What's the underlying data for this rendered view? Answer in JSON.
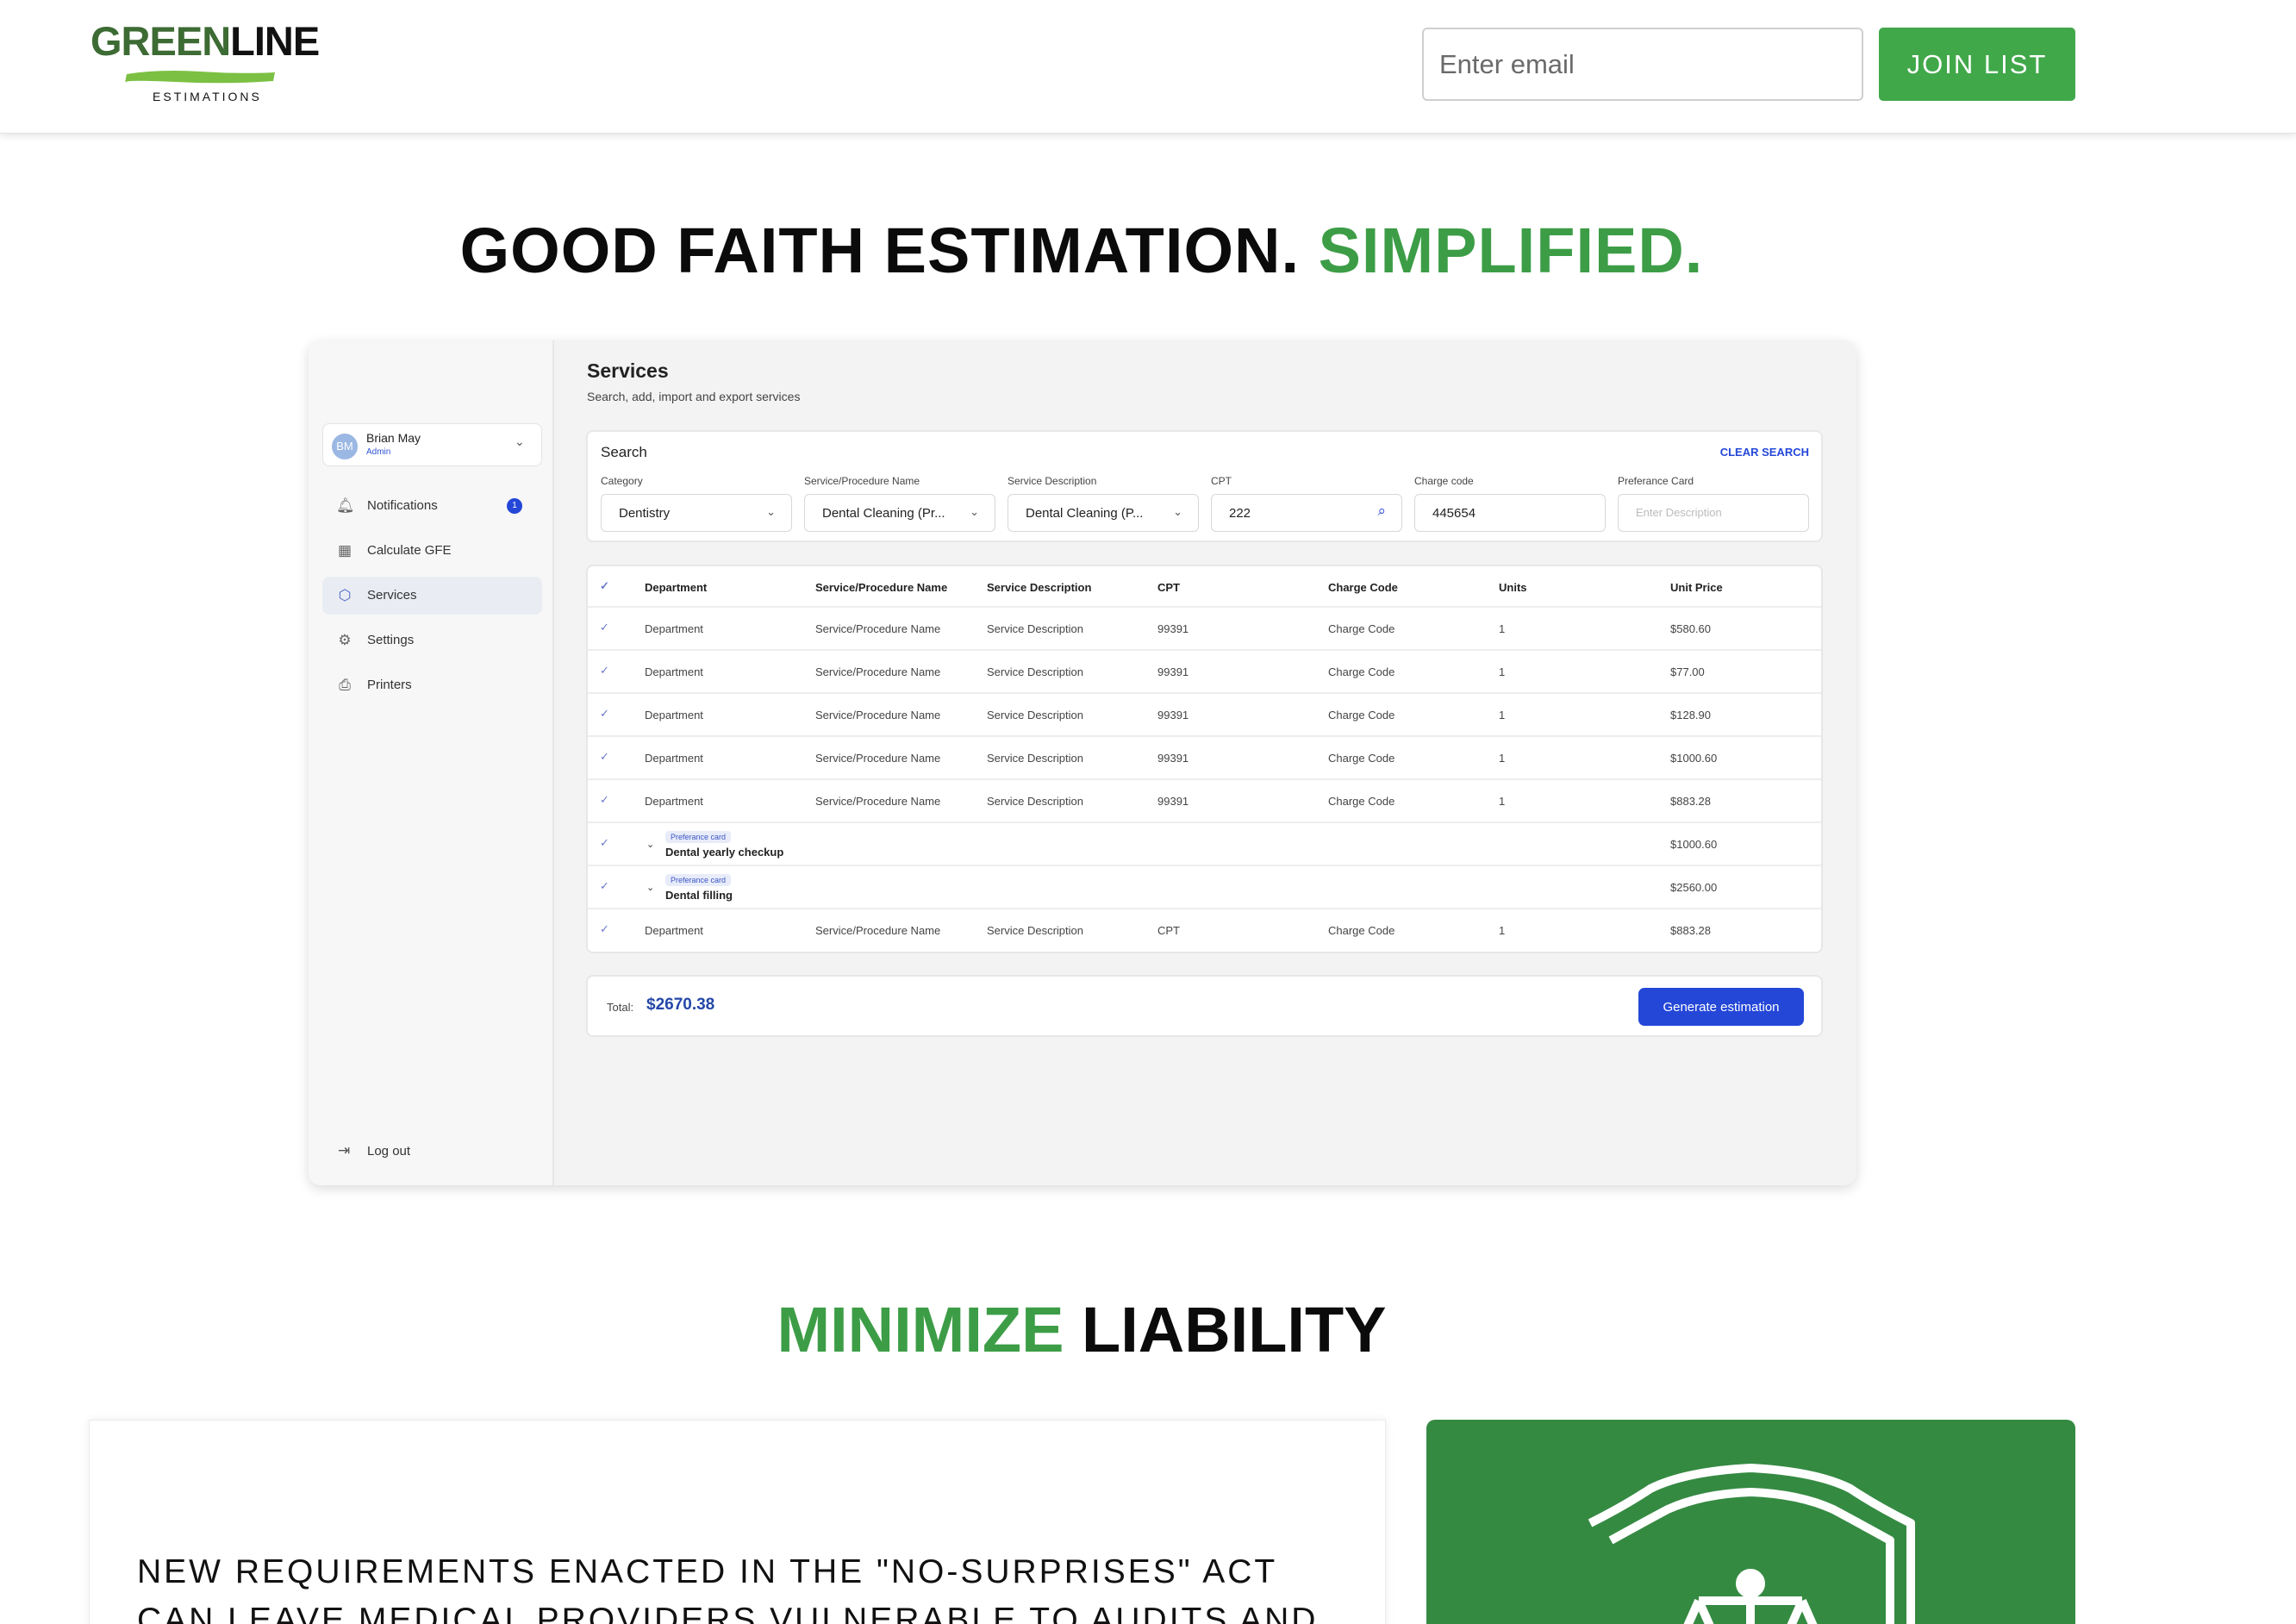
{
  "header": {
    "logo": {
      "green_part": "GREEN",
      "dark_part": "LINE",
      "subtitle": "ESTIMATIONS"
    },
    "email_placeholder": "Enter email",
    "join_label": "JOIN LIST"
  },
  "hero": {
    "title_dark": "GOOD FAITH ESTIMATION.",
    "title_green": "SIMPLIFIED."
  },
  "app": {
    "user": {
      "initials": "BM",
      "name": "Brian May",
      "role": "Admin"
    },
    "nav": [
      {
        "label": "Notifications",
        "icon": "bell-icon",
        "badge": "1"
      },
      {
        "label": "Calculate GFE",
        "icon": "calculator-icon"
      },
      {
        "label": "Services",
        "icon": "cube-icon",
        "active": true
      },
      {
        "label": "Settings",
        "icon": "gear-icon"
      },
      {
        "label": "Printers",
        "icon": "printer-icon"
      }
    ],
    "logout": "Log out",
    "page_title": "Services",
    "page_subtitle": "Search, add, import and export services",
    "search": {
      "title": "Search",
      "clear": "CLEAR SEARCH",
      "fields": [
        {
          "label": "Category",
          "value": "Dentistry"
        },
        {
          "label": "Service/Procedure Name",
          "value": "Dental Cleaning (Pr..."
        },
        {
          "label": "Service Description",
          "value": "Dental Cleaning (P..."
        },
        {
          "label": "CPT",
          "value": "222"
        },
        {
          "label": "Charge code",
          "value": "445654"
        },
        {
          "label": "Preferance Card",
          "placeholder": "Enter Description"
        }
      ]
    },
    "table": {
      "headers": [
        "Department",
        "Service/Procedure Name",
        "Service Description",
        "CPT",
        "Charge Code",
        "Units",
        "Unit Price"
      ],
      "rows": [
        {
          "dept": "Department",
          "name": "Service/Procedure Name",
          "desc": "Service Description",
          "cpt": "99391",
          "code": "Charge Code",
          "units": "1",
          "price": "$580.60"
        },
        {
          "dept": "Department",
          "name": "Service/Procedure Name",
          "desc": "Service Description",
          "cpt": "99391",
          "code": "Charge Code",
          "units": "1",
          "price": "$77.00"
        },
        {
          "dept": "Department",
          "name": "Service/Procedure Name",
          "desc": "Service Description",
          "cpt": "99391",
          "code": "Charge Code",
          "units": "1",
          "price": "$128.90"
        },
        {
          "dept": "Department",
          "name": "Service/Procedure Name",
          "desc": "Service Description",
          "cpt": "99391",
          "code": "Charge Code",
          "units": "1",
          "price": "$1000.60"
        },
        {
          "dept": "Department",
          "name": "Service/Procedure Name",
          "desc": "Service Description",
          "cpt": "99391",
          "code": "Charge Code",
          "units": "1",
          "price": "$883.28"
        },
        {
          "tag": "Preferance card",
          "card_name": "Dental yearly checkup",
          "price": "$1000.60"
        },
        {
          "tag": "Preferance card",
          "card_name": "Dental filling",
          "price": "$2560.00"
        },
        {
          "dept": "Department",
          "name": "Service/Procedure Name",
          "desc": "Service Description",
          "cpt": "CPT",
          "code": "Charge Code",
          "units": "1",
          "price": "$883.28"
        }
      ]
    },
    "total_label": "Total:",
    "total_value": "$2670.38",
    "generate_label": "Generate estimation"
  },
  "section2": {
    "title_green": "MINIMIZE",
    "title_dark": "LIABILITY",
    "body": "NEW REQUIREMENTS ENACTED IN THE \"NO-SURPRISES\" ACT CAN LEAVE MEDICAL PROVIDERS VULNERABLE TO AUDITS AND LEGAL",
    "icon": "shield-scales-icon"
  },
  "colors": {
    "brand_green": "#41a84a",
    "deep_green": "#358a42",
    "accent_blue": "#2447d8"
  }
}
